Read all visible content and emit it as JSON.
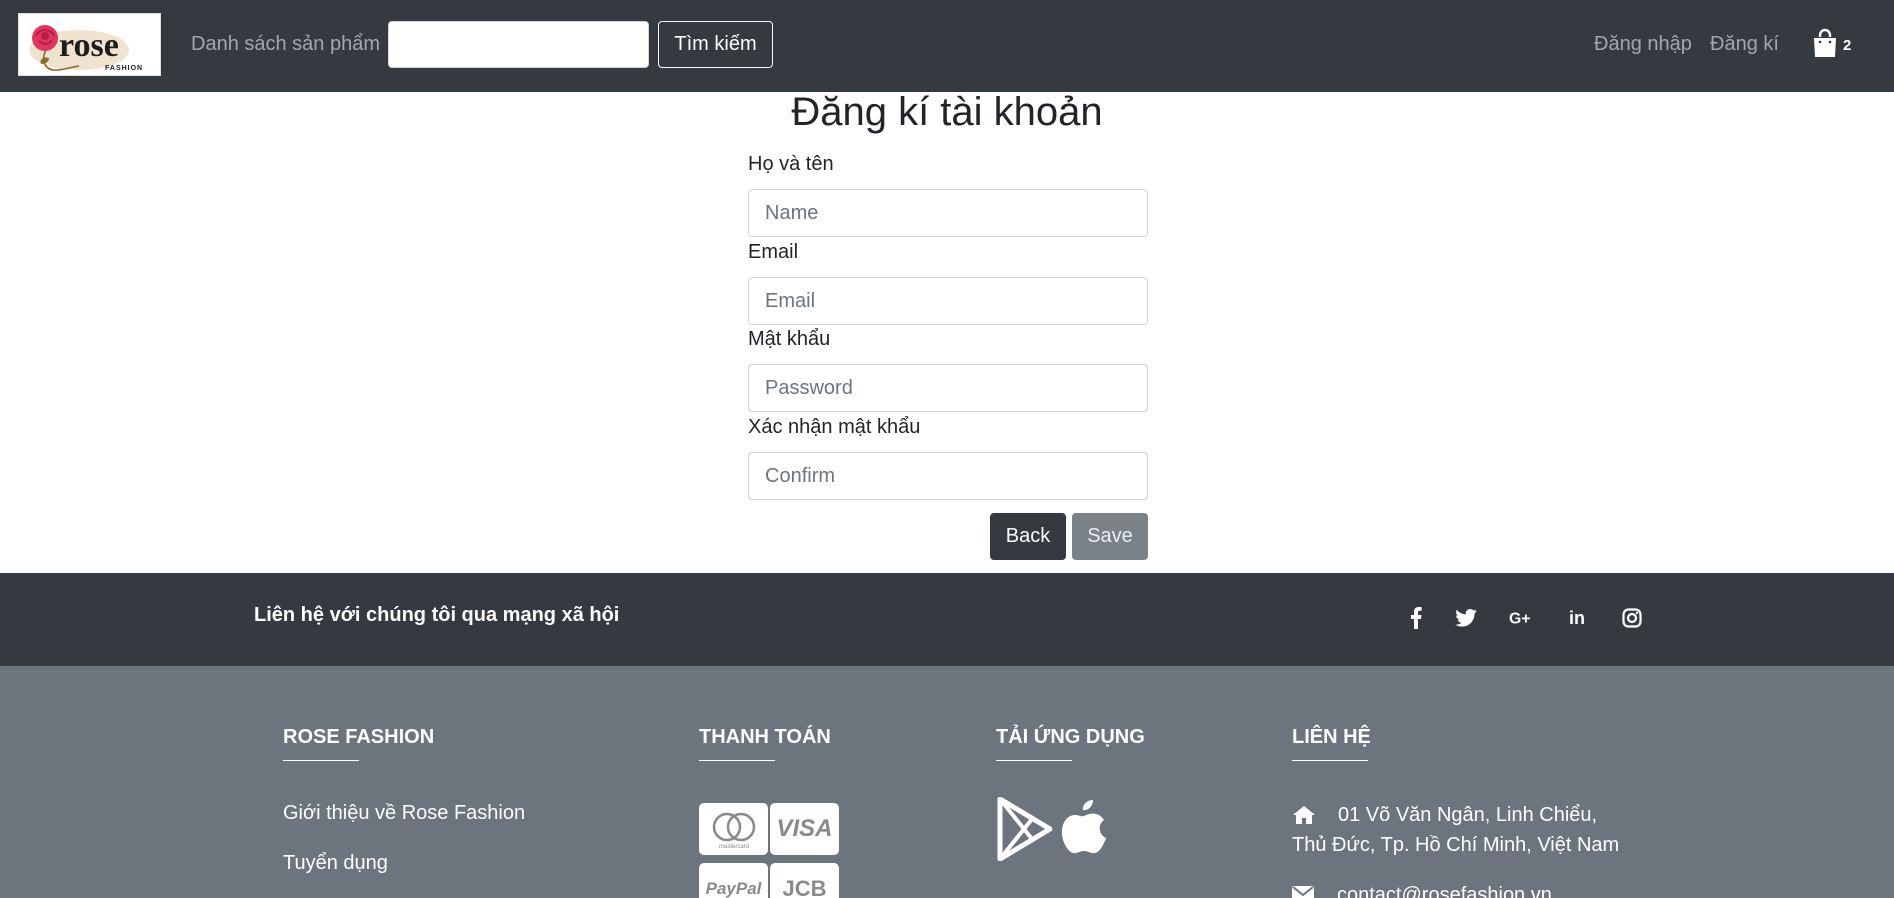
{
  "header": {
    "logo_text": "rose",
    "logo_subtext": "FASHION",
    "nav_products": "Danh sách sản phẩm",
    "search_placeholder": "",
    "search_button": "Tìm kiếm",
    "login": "Đăng nhập",
    "register": "Đăng kí",
    "cart_icon": "shopping-bag-icon",
    "cart_count": "2"
  },
  "form": {
    "title": "Đăng kí tài khoản",
    "fields": [
      {
        "label": "Họ và tên",
        "placeholder": "Name",
        "value": ""
      },
      {
        "label": "Email",
        "placeholder": "Email",
        "value": ""
      },
      {
        "label": "Mật khẩu",
        "placeholder": "Password",
        "value": ""
      },
      {
        "label": "Xác nhận mật khẩu",
        "placeholder": "Confirm",
        "value": ""
      }
    ],
    "back_button": "Back",
    "save_button": "Save"
  },
  "social": {
    "text": "Liên hệ với chúng tôi qua mạng xã hội",
    "icons": [
      "facebook-icon",
      "twitter-icon",
      "google-plus-icon",
      "linkedin-icon",
      "instagram-icon"
    ]
  },
  "footer": {
    "col1": {
      "heading": "ROSE FASHION",
      "links": [
        "Giới thiệu về Rose Fashion",
        "Tuyển dụng"
      ]
    },
    "col2": {
      "heading": "THANH TOÁN",
      "cards": [
        "mastercard",
        "VISA",
        "PayPal",
        "JCB"
      ]
    },
    "col3": {
      "heading": "TẢI ỨNG DỤNG",
      "icons": [
        "google-play-icon",
        "apple-icon"
      ]
    },
    "col4": {
      "heading": "LIÊN HỆ",
      "address_line1": "01 Võ Văn Ngân, Linh Chiểu,",
      "address_line2": "Thủ Đức, Tp. Hồ Chí Minh, Việt Nam",
      "email": "contact@rosefashion.vn"
    }
  },
  "colors": {
    "header_bg": "#343a40",
    "footer_bg": "#6c757d",
    "logo_accent": "#e0355e"
  }
}
